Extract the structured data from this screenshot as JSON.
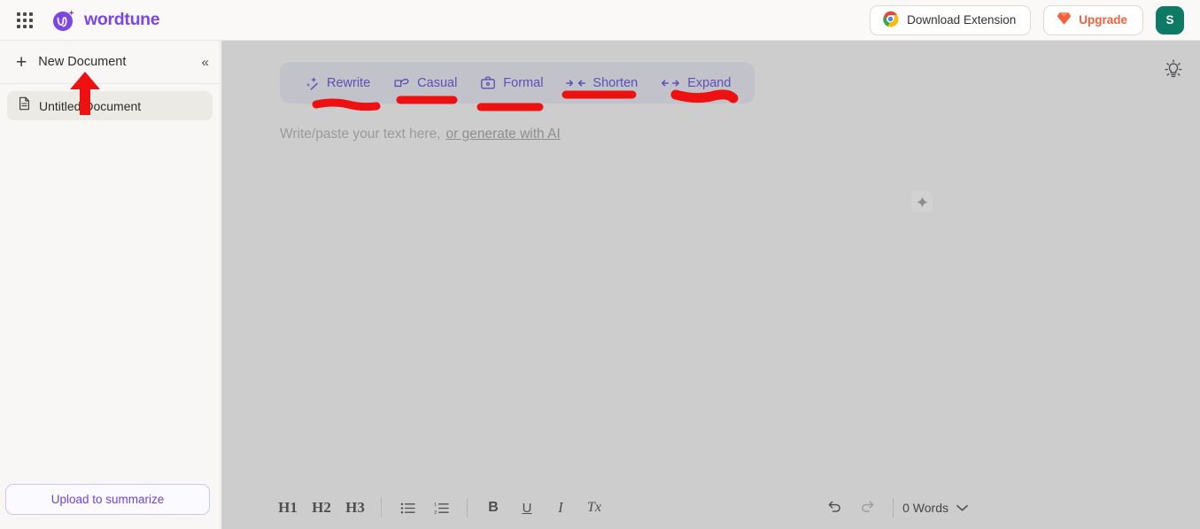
{
  "topbar": {
    "apps_icon": "grid-apps-icon",
    "brand": "wordtune",
    "download_extension": "Download Extension",
    "chrome_icon": "chrome-icon",
    "upgrade": "Upgrade",
    "gem_icon": "gem-icon",
    "avatar_initial": "S"
  },
  "sidebar": {
    "new_document": "New Document",
    "plus_icon": "plus-icon",
    "collapse_icon": "chevron-double-left-icon",
    "documents": [
      {
        "label": "Untitled Document",
        "icon": "document-icon",
        "active": true
      }
    ],
    "upload_button": "Upload to summarize"
  },
  "main": {
    "bulb_icon": "lightbulb-icon",
    "toolbar": [
      {
        "label": "Rewrite",
        "icon": "sparkle-wand-icon"
      },
      {
        "label": "Casual",
        "icon": "casual-hand-icon"
      },
      {
        "label": "Formal",
        "icon": "briefcase-icon"
      },
      {
        "label": "Shorten",
        "icon": "arrows-inward-icon"
      },
      {
        "label": "Expand",
        "icon": "arrows-outward-icon"
      }
    ],
    "placeholder_text": "Write/paste your text here,",
    "generate_link": "or generate with AI",
    "sparkle_button_icon": "sparkle-icon"
  },
  "editor_toolbar": {
    "headings": [
      "H1",
      "H2",
      "H3"
    ],
    "lists": [
      "bullet-list-icon",
      "numbered-list-icon"
    ],
    "formats": [
      "bold-icon",
      "underline-icon",
      "italic-icon",
      "clear-format-icon"
    ],
    "bold_label": "B",
    "underline_label": "U",
    "italic_label": "I",
    "clear_label": "Tx",
    "undo_icon": "undo-icon",
    "redo_icon": "redo-icon",
    "word_count": "0 Words",
    "chevron_icon": "chevron-down-icon"
  },
  "annotations": {
    "arrow_target": "New Document",
    "underlined_items": [
      "Rewrite",
      "Casual",
      "Formal",
      "Shorten",
      "Expand"
    ],
    "color": "#ee1111"
  },
  "colors": {
    "brand_purple": "#7b46e3",
    "upgrade_orange": "#f2603c",
    "avatar_teal": "#0d7a66",
    "annotation_red": "#ee1111",
    "overlay_grey": "#cdcdcd"
  }
}
